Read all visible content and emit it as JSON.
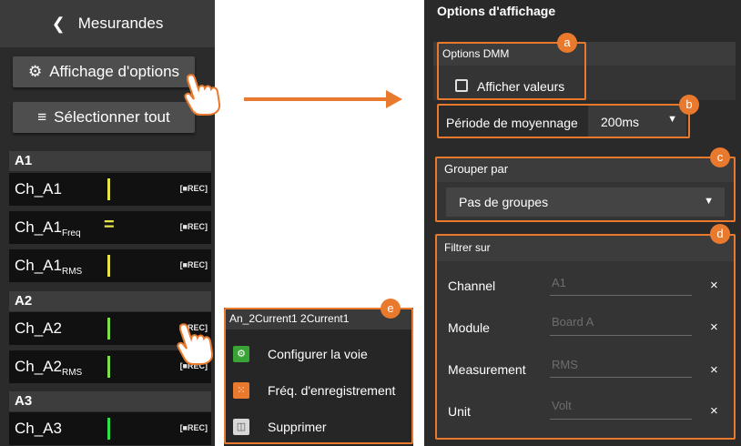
{
  "left_panel": {
    "header_title": "Mesurandes",
    "display_options_label": "Affichage d'options",
    "select_all_label": "Sélectionner tout",
    "rec_label": "[■REC]",
    "groups": [
      {
        "name": "A1"
      },
      {
        "name": "A2"
      },
      {
        "name": "A3"
      }
    ],
    "channels": [
      {
        "base": "Ch_A1",
        "sub": ""
      },
      {
        "base": "Ch_A1",
        "sub": "Freq"
      },
      {
        "base": "Ch_A1",
        "sub": "RMS"
      },
      {
        "base": "Ch_A2",
        "sub": ""
      },
      {
        "base": "Ch_A2",
        "sub": "RMS"
      },
      {
        "base": "Ch_A3",
        "sub": ""
      }
    ]
  },
  "context_menu": {
    "title": "An_2Current1 2Current1",
    "items": [
      {
        "label": "Configurer la voie",
        "icon": "gear-icon",
        "color": "#3aa335"
      },
      {
        "label": "Fréq. d'enregistrement",
        "icon": "frequency-icon",
        "color": "#e8792d"
      },
      {
        "label": "Supprimer",
        "icon": "trash-icon",
        "color": "#d8d8d8"
      }
    ]
  },
  "right_panel": {
    "title": "Options d'affichage",
    "dmm_section_title": "Options DMM",
    "show_values_label": "Afficher valeurs",
    "averaging_label": "Période de moyennage",
    "averaging_value": "200ms",
    "group_by_title": "Grouper par",
    "group_by_value": "Pas de groupes",
    "filter_title": "Filtrer sur",
    "filters": [
      {
        "label": "Channel",
        "value": "A1"
      },
      {
        "label": "Module",
        "value": "Board A"
      },
      {
        "label": "Measurement",
        "value": "RMS"
      },
      {
        "label": "Unit",
        "value": "Volt"
      }
    ],
    "clear_symbol": "×"
  },
  "callouts": {
    "a": "a",
    "b": "b",
    "c": "c",
    "d": "d",
    "e": "e"
  },
  "colors": {
    "accent": "#e8792d",
    "channel_bar_yellow": "#e5e44a",
    "channel_bar_green": "#7ee047",
    "channel_bar_bright_green": "#2fe04a"
  }
}
